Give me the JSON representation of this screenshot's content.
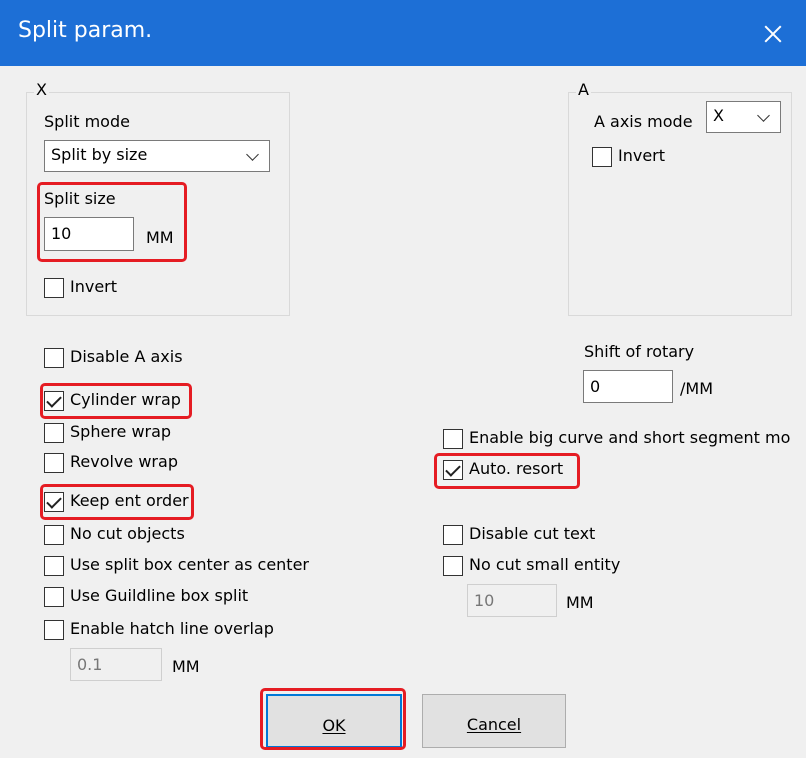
{
  "window": {
    "title": "Split param."
  },
  "x_group": {
    "title": "X",
    "split_mode_label": "Split mode",
    "split_mode_value": "Split by size",
    "split_size_label": "Split size",
    "split_size_value": "10",
    "unit": "MM",
    "invert_label": "Invert"
  },
  "a_group": {
    "title": "A",
    "axis_mode_label": "A axis mode",
    "axis_mode_value": "X",
    "invert_label": "Invert"
  },
  "options_left": [
    {
      "label": "Disable A axis",
      "checked": false
    },
    {
      "label": "Cylinder wrap",
      "checked": true
    },
    {
      "label": "Sphere wrap",
      "checked": false
    },
    {
      "label": "Revolve wrap",
      "checked": false
    },
    {
      "label": "Keep ent order",
      "checked": true
    },
    {
      "label": "No cut objects",
      "checked": false
    },
    {
      "label": "Use split box center as center",
      "checked": false
    },
    {
      "label": "Use Guildline box split",
      "checked": false
    },
    {
      "label": "Enable hatch line overlap",
      "checked": false
    }
  ],
  "hatch_overlap": {
    "value": "0.1",
    "unit": "MM"
  },
  "shift_rotary": {
    "label": "Shift of rotary",
    "value": "0",
    "unit": "/MM"
  },
  "options_right": [
    {
      "label": "Enable big curve and short segment mo",
      "checked": false
    },
    {
      "label": "Auto. resort",
      "checked": true
    },
    {
      "label": "Disable cut text",
      "checked": false
    },
    {
      "label": "No cut small entity",
      "checked": false
    }
  ],
  "small_entity": {
    "value": "10",
    "unit": "MM"
  },
  "buttons": {
    "ok": "OK",
    "cancel": "Cancel"
  },
  "colors": {
    "titlebar": "#1d6fd6",
    "highlight": "#e51c23",
    "dialog_bg": "#f0f0f0"
  }
}
